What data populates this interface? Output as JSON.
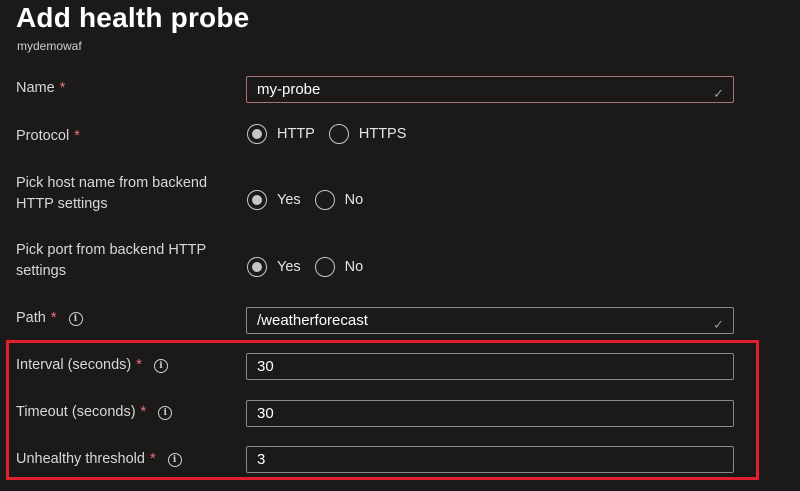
{
  "page": {
    "title": "Add health probe",
    "subtitle": "mydemowaf"
  },
  "fields": {
    "name": {
      "label": "Name",
      "required": "*",
      "value": "my-probe"
    },
    "protocol": {
      "label": "Protocol",
      "required": "*",
      "options": [
        "HTTP",
        "HTTPS"
      ],
      "selected": "HTTP"
    },
    "pick_host": {
      "label_line1": "Pick host name from backend",
      "label_line2": "HTTP settings",
      "options": [
        "Yes",
        "No"
      ],
      "selected": "Yes"
    },
    "pick_port": {
      "label_line1": "Pick port from backend HTTP",
      "label_line2": "settings",
      "options": [
        "Yes",
        "No"
      ],
      "selected": "Yes"
    },
    "path": {
      "label": "Path",
      "required": "*",
      "value": "/weatherforecast"
    },
    "interval": {
      "label": "Interval (seconds)",
      "required": "*",
      "value": "30"
    },
    "timeout": {
      "label": "Timeout (seconds)",
      "required": "*",
      "value": "30"
    },
    "unhealthy_threshold": {
      "label": "Unhealthy threshold",
      "required": "*",
      "value": "3"
    }
  },
  "icons": {
    "info": "i",
    "check": "✓"
  },
  "colors": {
    "background": "#1b1a19",
    "required_asterisk": "#f1707b",
    "highlight_border": "#e0202c"
  }
}
